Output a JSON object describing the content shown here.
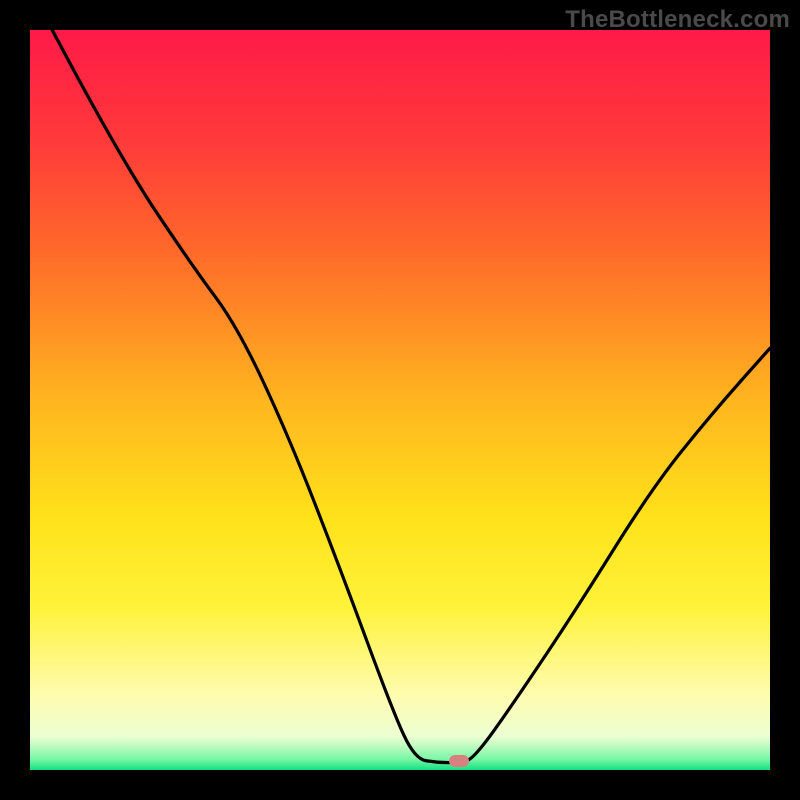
{
  "watermark": "TheBottleneck.com",
  "colors": {
    "frame": "#000000",
    "watermark_text": "#4a4a4a",
    "curve": "#000000",
    "marker": "#d98080",
    "gradient_stops": [
      {
        "offset": 0.0,
        "color": "#ff1a47"
      },
      {
        "offset": 0.15,
        "color": "#ff3a3a"
      },
      {
        "offset": 0.3,
        "color": "#ff6a2a"
      },
      {
        "offset": 0.5,
        "color": "#ffb51f"
      },
      {
        "offset": 0.66,
        "color": "#ffe21a"
      },
      {
        "offset": 0.78,
        "color": "#fff23a"
      },
      {
        "offset": 0.9,
        "color": "#fffcb0"
      },
      {
        "offset": 0.955,
        "color": "#ecffd2"
      },
      {
        "offset": 0.985,
        "color": "#7cf7a6"
      },
      {
        "offset": 1.0,
        "color": "#12e082"
      }
    ]
  },
  "chart_data": {
    "type": "line",
    "title": "",
    "xlabel": "",
    "ylabel": "",
    "x_range": [
      0,
      100
    ],
    "y_range": [
      0,
      100
    ],
    "series": [
      {
        "name": "bottleneck-curve",
        "points": [
          {
            "x": 3,
            "y": 100
          },
          {
            "x": 12,
            "y": 83
          },
          {
            "x": 22,
            "y": 68
          },
          {
            "x": 28,
            "y": 60
          },
          {
            "x": 35,
            "y": 45
          },
          {
            "x": 42,
            "y": 27
          },
          {
            "x": 49,
            "y": 8
          },
          {
            "x": 52,
            "y": 1.5
          },
          {
            "x": 55,
            "y": 1.0
          },
          {
            "x": 58,
            "y": 1.0
          },
          {
            "x": 60,
            "y": 1.5
          },
          {
            "x": 66,
            "y": 10
          },
          {
            "x": 74,
            "y": 22
          },
          {
            "x": 84,
            "y": 38
          },
          {
            "x": 92,
            "y": 48
          },
          {
            "x": 100,
            "y": 57
          }
        ]
      }
    ],
    "marker": {
      "x": 58,
      "y": 1.2,
      "color": "#d98080"
    },
    "background": "vertical-gradient-red-to-green"
  }
}
